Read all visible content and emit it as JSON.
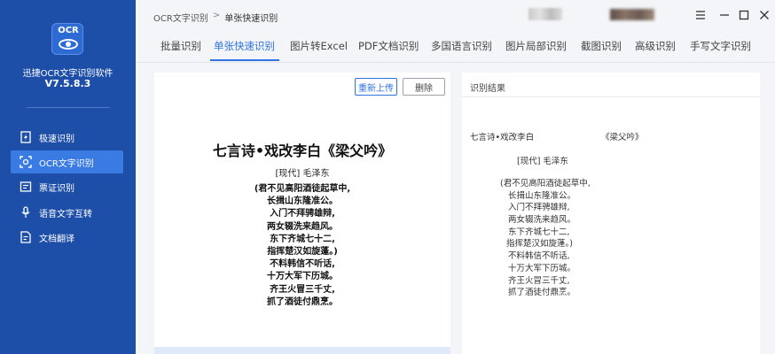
{
  "app": {
    "logo_text": "OCR",
    "name": "迅捷OCR文字识别软件",
    "version": "V7.5.8.3"
  },
  "sidebar": {
    "items": [
      {
        "label": "极速识别",
        "icon": "lightning-doc-icon"
      },
      {
        "label": "OCR文字识别",
        "icon": "ocr-scan-icon"
      },
      {
        "label": "票证识别",
        "icon": "ticket-icon"
      },
      {
        "label": "语音文字互转",
        "icon": "microphone-icon"
      },
      {
        "label": "文档翻译",
        "icon": "translate-doc-icon"
      }
    ]
  },
  "breadcrumb": {
    "root": "OCR文字识别",
    "separator": ">",
    "current": "单张快速识别"
  },
  "window_controls": [
    "menu-icon",
    "minimize-icon",
    "maximize-icon",
    "close-icon"
  ],
  "tabs": [
    {
      "label": "批量识别"
    },
    {
      "label": "单张快速识别"
    },
    {
      "label": "图片转Excel"
    },
    {
      "label": "PDF文档识别"
    },
    {
      "label": "多国语言识别"
    },
    {
      "label": "图片局部识别"
    },
    {
      "label": "截图识别"
    },
    {
      "label": "高级识别"
    },
    {
      "label": "手写文字识别"
    }
  ],
  "preview": {
    "reupload_label": "重新上传",
    "delete_label": "删除",
    "title": "七言诗•戏改李白《梁父吟》",
    "author": "[现代] 毛泽东",
    "lines": [
      "(君不见高阳酒徒起草中,",
      "长揖山东隆准公。",
      "入门不拜骋雄辩,",
      "两女辍洗来趋风。",
      "东下齐城七十二,",
      "指挥楚汉如旋蓬。)",
      "不料韩信不听话,",
      "十万大军下历城。",
      "齐王火冒三千丈,",
      "抓了酒徒付鼎烹。"
    ]
  },
  "result": {
    "header": "识别结果",
    "title_left": "七言诗•戏改李白",
    "title_right": "《梁父吟》",
    "author": "[现代] 毛泽东",
    "lines": [
      "(君不见高阳酒徒起草中,",
      "长揖山东隆准公。",
      "入门不拜骋雄辩,",
      "两女辍洗来趋风。",
      "东下齐城七十二,",
      "指挥楚汉如旋蓬。)",
      "不料韩信不听话,",
      "十万大军下历城。",
      "齐王火冒三千丈,",
      "抓了酒徒付鼎烹。"
    ]
  },
  "colors": {
    "sidebar_bg": "#1e4fa8",
    "accent": "#2e73e0",
    "active_nav": "#3a7ae3"
  }
}
